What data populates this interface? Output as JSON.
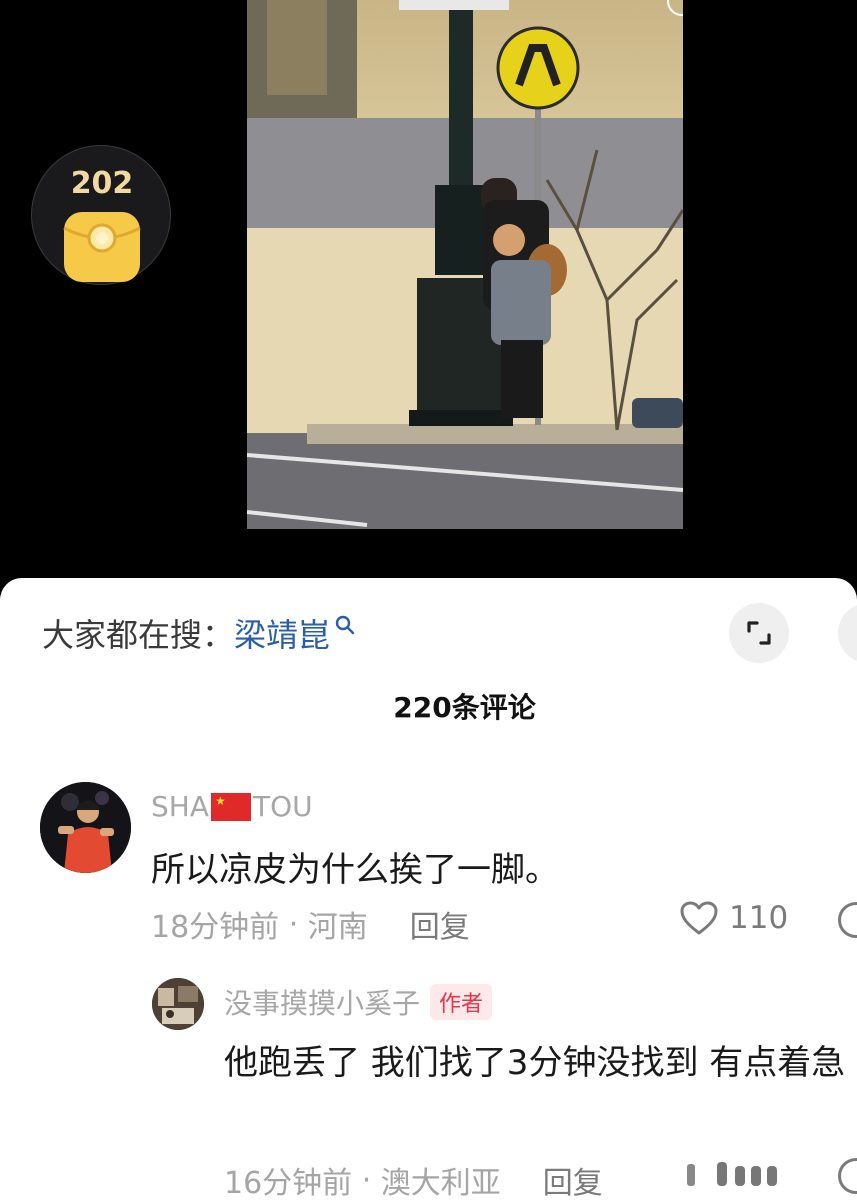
{
  "rewards": {
    "coin_count": "202"
  },
  "search": {
    "prefix": "大家都在搜：",
    "term": "梁靖崑"
  },
  "comments_header": {
    "title": "220条评论"
  },
  "comment": {
    "username_before_flag": "SHA",
    "username_after_flag": "TOU",
    "text": "所以凉皮为什么挨了一脚。",
    "time": "18分钟前",
    "location": "河南",
    "reply_label": "回复",
    "likes": "110"
  },
  "reply": {
    "username": "没事摸摸小奚子",
    "badge": "作者",
    "text": "他跑丢了 我们找了3分钟没找到 有点着急 。",
    "time": "16分钟前",
    "location": "澳大利亚",
    "reply_label": "回复"
  },
  "icons": {
    "coin": "red-envelope-icon",
    "search": "search-icon",
    "expand": "expand-icon",
    "like": "heart-icon"
  },
  "colors": {
    "link_blue": "#2a5ea8",
    "author_badge": "#e8334a",
    "coin_gold": "#f3d9a0"
  }
}
